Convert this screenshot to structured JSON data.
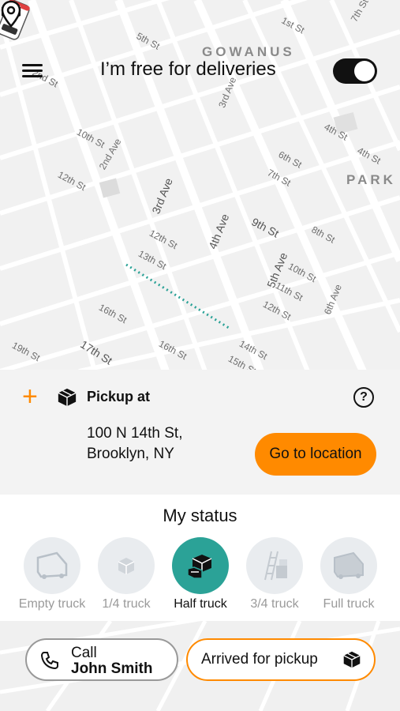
{
  "map": {
    "area_labels": [
      "GOWANUS",
      "PARK"
    ],
    "streets": [
      "5th St",
      "1st St",
      "2nd St",
      "3rd Ave",
      "10th St",
      "2nd Ave",
      "12th St",
      "3rd Ave",
      "4th St",
      "4th St",
      "6th St",
      "7th St",
      "9th St",
      "8th St",
      "12th St",
      "13th St",
      "4th Ave",
      "5th Ave",
      "10th St",
      "11th St",
      "6th Ave",
      "12th St",
      "16th St",
      "17th St",
      "16th St",
      "14th St",
      "15th St",
      "19th St",
      "7th St"
    ]
  },
  "header": {
    "title": "I’m free for deliveries",
    "available_toggle": "on"
  },
  "pickup": {
    "label": "Pickup at",
    "address_line1": "100 N 14th St,",
    "address_line2": "Brooklyn, NY",
    "go_button": "Go to location",
    "help": "?"
  },
  "status": {
    "title": "My status",
    "options": [
      {
        "label": "Empty truck",
        "icon": "empty-truck-icon"
      },
      {
        "label": "1/4 truck",
        "icon": "quarter-box-icon"
      },
      {
        "label": "Half truck",
        "icon": "half-boxes-icon"
      },
      {
        "label": "3/4 truck",
        "icon": "ladder-boxes-icon"
      },
      {
        "label": "Full truck",
        "icon": "full-truck-icon"
      }
    ],
    "selected": "Half truck"
  },
  "actions": {
    "call_line1": "Call",
    "call_line2": "John Smith",
    "arrived": "Arrived for pickup"
  },
  "colors": {
    "accent": "#ff8a00",
    "teal": "#2ba297",
    "route": "#2ba297"
  }
}
